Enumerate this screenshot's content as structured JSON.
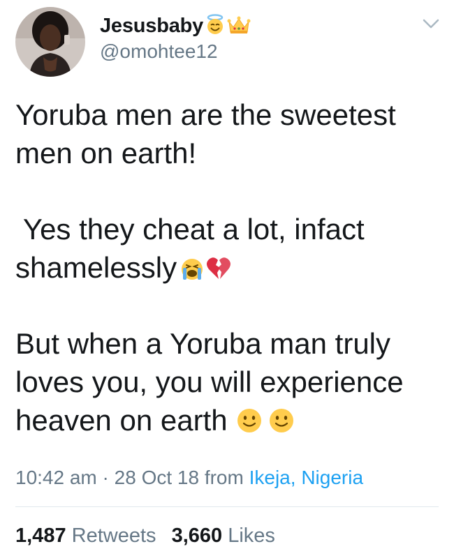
{
  "user": {
    "display_name": "Jesusbaby",
    "handle": "@omohtee12",
    "name_emojis": [
      "smiling-face-with-halo-icon",
      "crown-icon"
    ]
  },
  "tweet": {
    "lines": [
      "Yoruba men are the sweetest",
      "men on earth!",
      "",
      " Yes they cheat a lot, infact",
      "shamelessly",
      "",
      "But when a Yoruba man truly",
      "loves you, you will experience",
      "heaven on earth "
    ],
    "inline_emojis": {
      "line5": [
        "loudly-crying-face-icon",
        "broken-heart-icon"
      ],
      "line9": [
        "slightly-smiling-face-icon",
        "slightly-smiling-face-icon"
      ]
    }
  },
  "meta": {
    "time": "10:42 am",
    "separator": " · ",
    "date": "28 Oct 18",
    "from_label": " from ",
    "location": "Ikeja, Nigeria"
  },
  "stats": {
    "retweets_count": "1,487",
    "retweets_label": "Retweets",
    "likes_count": "3,660",
    "likes_label": "Likes"
  },
  "colors": {
    "text": "#14171a",
    "secondary": "#657786",
    "link": "#1da1f2",
    "divider": "#e1e8ed"
  }
}
